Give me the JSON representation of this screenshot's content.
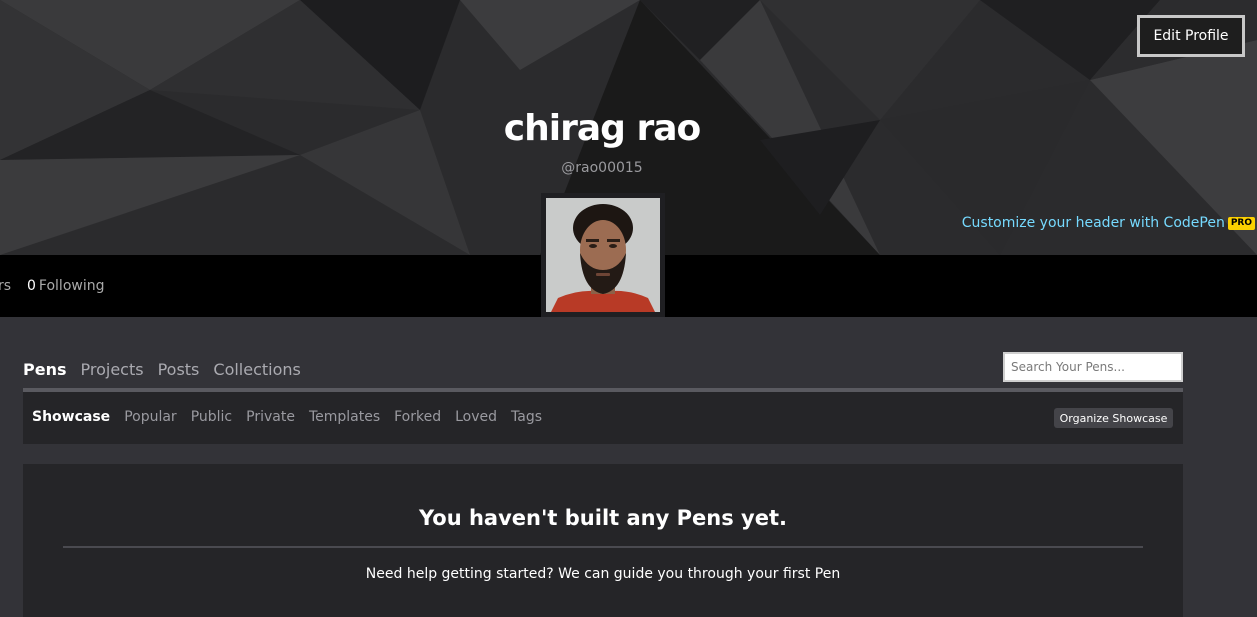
{
  "header": {
    "edit_profile_label": "Edit Profile",
    "name": "chirag rao",
    "handle": "@rao00015",
    "customize_text": "Customize your header with CodePen",
    "pro_badge": "PRO"
  },
  "stats": {
    "followers_partial": "rs",
    "following_count": "0",
    "following_label": "Following"
  },
  "tabs": [
    {
      "label": "Pens",
      "active": true
    },
    {
      "label": "Projects"
    },
    {
      "label": "Posts"
    },
    {
      "label": "Collections"
    }
  ],
  "search": {
    "placeholder": "Search Your Pens..."
  },
  "subtabs": [
    {
      "label": "Showcase",
      "active": true
    },
    {
      "label": "Popular"
    },
    {
      "label": "Public"
    },
    {
      "label": "Private"
    },
    {
      "label": "Templates"
    },
    {
      "label": "Forked"
    },
    {
      "label": "Loved"
    },
    {
      "label": "Tags"
    }
  ],
  "organize_label": "Organize Showcase",
  "empty_state": {
    "title": "You haven't built any Pens yet.",
    "help": "Need help getting started? We can guide you through your first Pen"
  },
  "colors": {
    "link": "#76daff",
    "pro_badge": "#fcd000",
    "page_bg": "#333338",
    "panel_bg": "#252528"
  }
}
